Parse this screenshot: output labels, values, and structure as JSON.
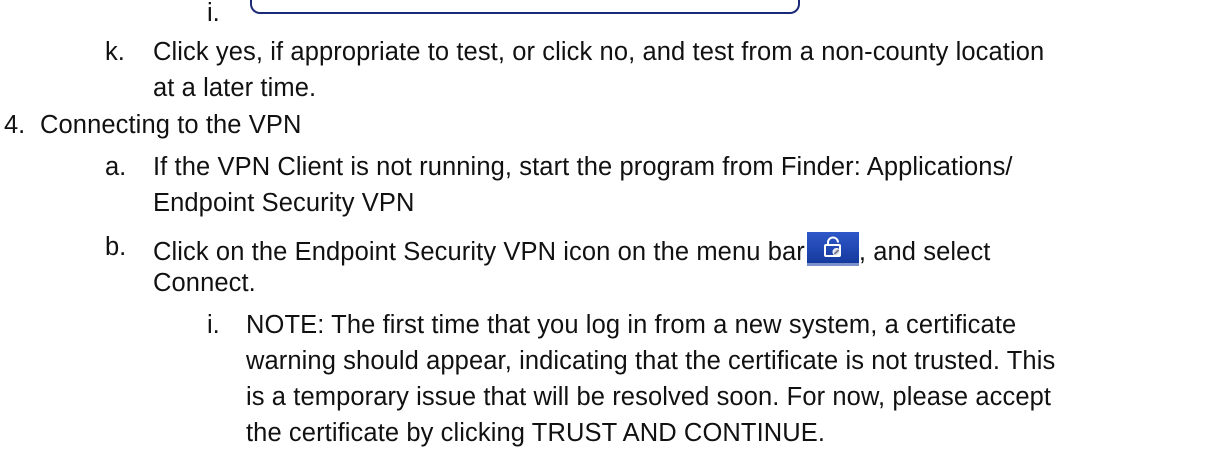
{
  "top_item": {
    "marker": "i."
  },
  "item_k": {
    "marker": "k.",
    "lines": [
      "Click yes, if appropriate to test, or click no, and test from a non-county location",
      "at a later time."
    ]
  },
  "section_4": {
    "marker": "4.",
    "heading": "Connecting to the VPN"
  },
  "item_a": {
    "marker": "a.",
    "lines": [
      "If the VPN Client is not running, start the program from Finder: Applications/",
      "Endpoint Security VPN"
    ]
  },
  "item_b": {
    "marker": "b.",
    "text_before_icon": "Click on the Endpoint Security VPN icon on the menu bar",
    "text_after_icon": ", and select",
    "line2": "Connect.",
    "icon": "vpn-lock-icon",
    "icon_colors": {
      "top": "#2f58c9",
      "bottom": "#153a9e",
      "underline": "#7a91c9",
      "glyph": "#ffffff"
    }
  },
  "note": {
    "marker": "i.",
    "lines": [
      "NOTE: The first time that you log in from a new system, a certificate",
      "warning should appear, indicating that the certificate is not trusted.  This",
      "is a temporary issue that will be resolved soon.  For now, please accept",
      "the certificate by clicking TRUST AND CONTINUE."
    ]
  },
  "colors": {
    "text": "#111111",
    "frame_border": "#1b2a78"
  }
}
